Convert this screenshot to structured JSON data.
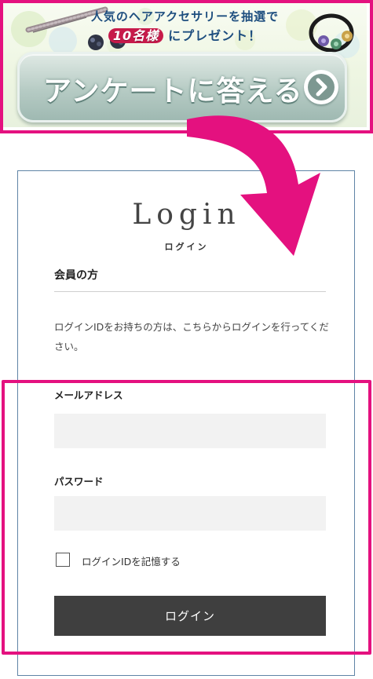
{
  "banner": {
    "line1": "人気のヘアアクセサリーを抽選で",
    "prize_count": "10名様",
    "line2_suffix": "にプレゼント！",
    "cta_label": "アンケートに答える",
    "cta_icon": "chevron-right-circle-icon",
    "accent_color": "#e4117f",
    "text_color": "#1e4e7f"
  },
  "login": {
    "title": "Login",
    "subtitle": "ログイン",
    "member_heading": "会員の方",
    "description": "ログインIDをお持ちの方は、こちらからログインを行ってください。",
    "email_label": "メールアドレス",
    "email_value": "",
    "password_label": "パスワード",
    "password_value": "",
    "remember_label": "ログインIDを記憶する",
    "remember_checked": false,
    "submit_label": "ログイン",
    "button_color": "#3f3f3f",
    "border_color": "#5f84a6"
  }
}
